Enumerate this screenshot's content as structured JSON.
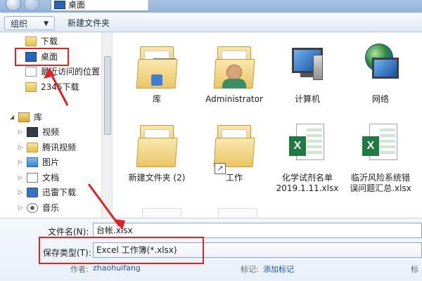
{
  "window": {
    "address": "桌面"
  },
  "toolbar": {
    "organize_label": "组织",
    "organize_arrow": "▼",
    "new_folder_label": "新建文件夹"
  },
  "nav": {
    "items": [
      {
        "label": "下载",
        "icon": "folder-icon"
      },
      {
        "label": "桌面",
        "icon": "desktop-icon"
      },
      {
        "label": "最近访问的位置",
        "icon": "recent-places-icon"
      },
      {
        "label": "2345下载",
        "icon": "folder-icon"
      },
      {
        "label": "库",
        "icon": "library-icon"
      },
      {
        "label": "视频",
        "icon": "video-library-icon"
      },
      {
        "label": "腾讯视频",
        "icon": "folder-icon"
      },
      {
        "label": "图片",
        "icon": "pictures-library-icon"
      },
      {
        "label": "文档",
        "icon": "documents-library-icon"
      },
      {
        "label": "迅雷下载",
        "icon": "thunder-download-icon"
      },
      {
        "label": "音乐",
        "icon": "music-library-icon"
      }
    ]
  },
  "files": [
    {
      "name": "库",
      "icon": "library-folder-icon"
    },
    {
      "name": "Administrator",
      "icon": "user-folder-icon"
    },
    {
      "name": "计算机",
      "icon": "computer-icon"
    },
    {
      "name": "网络",
      "icon": "network-icon"
    },
    {
      "name": "新建文件夹 (2)",
      "icon": "folder-icon"
    },
    {
      "name": "工作",
      "icon": "folder-shortcut-icon"
    },
    {
      "name": "化学试剂名单\n2019.1.11.xlsx",
      "icon": "excel-file-icon"
    },
    {
      "name": "临沂风险系统错\n误问题汇总.xlsx",
      "icon": "excel-file-icon"
    }
  ],
  "form": {
    "filename_label": "文件名(N):",
    "filename_value": "台帐.xlsx",
    "type_label": "保存类型(T):",
    "type_value": "Excel 工作簿(*.xlsx)",
    "author_label": "作者:",
    "author_value": "zhaohuifang",
    "tags_label": "标记:",
    "tags_value": "添加标记",
    "tail_label": "标"
  },
  "colors": {
    "annotation": "#e02222",
    "link": "#1a56b8",
    "excel_green": "#1f7b41"
  }
}
